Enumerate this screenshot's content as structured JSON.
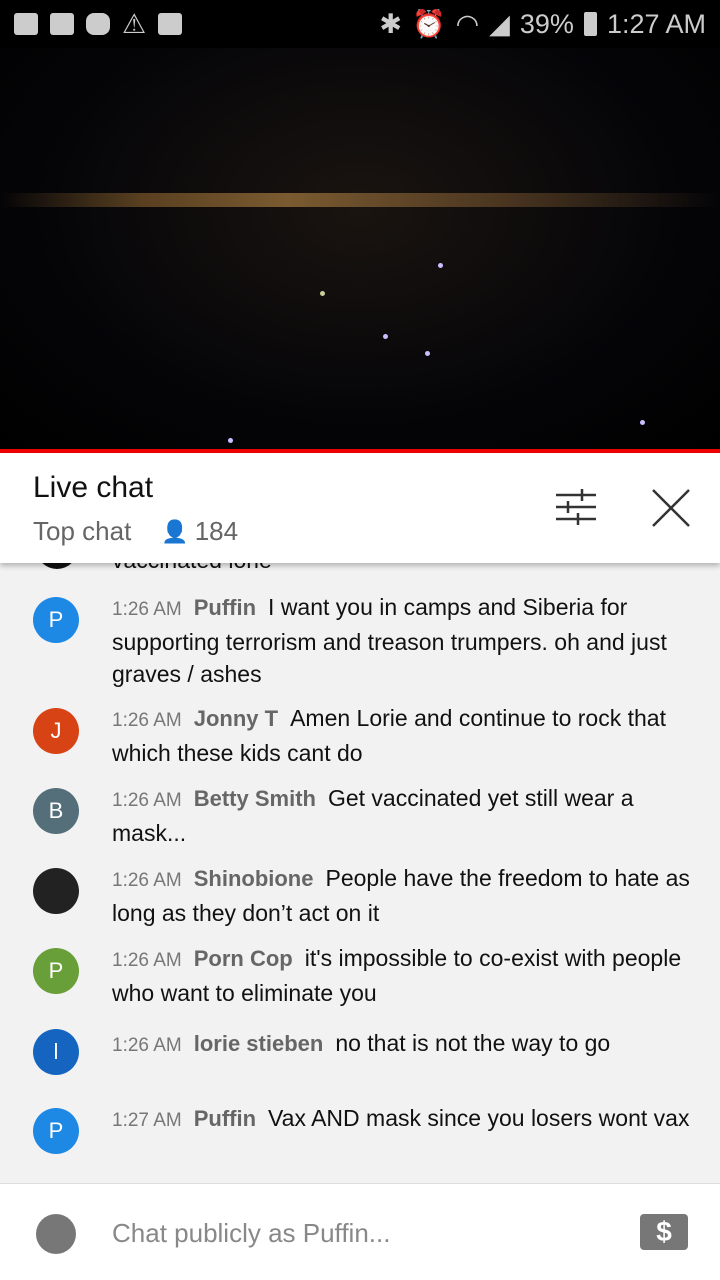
{
  "status": {
    "battery": "39%",
    "time": "1:27 AM"
  },
  "header": {
    "title": "Live chat",
    "mode": "Top chat",
    "viewers": "184"
  },
  "chat": {
    "partial": "vaccinated lorie",
    "messages": [
      {
        "time": "1:26 AM",
        "author": "Puffin",
        "text": "I want you in camps and Siberia for supporting terrorism and treason trumpers. oh and just graves / ashes",
        "initial": "P",
        "color": "#1e88e5"
      },
      {
        "time": "1:26 AM",
        "author": "Jonny T",
        "text": "Amen Lorie and continue to rock that which these kids cant do",
        "initial": "J",
        "color": "#d84315"
      },
      {
        "time": "1:26 AM",
        "author": "Betty Smith",
        "text": "Get vaccinated yet still wear a mask...",
        "initial": "B",
        "color": "#546e7a"
      },
      {
        "time": "1:26 AM",
        "author": "Shinobione",
        "text": "People have the freedom to hate as long as they don’t act on it",
        "initial": "",
        "color": "#222222"
      },
      {
        "time": "1:26 AM",
        "author": "Porn Cop",
        "text": "it's impossible to co-exist with people who want to eliminate you",
        "initial": "P",
        "color": "#689f38"
      },
      {
        "time": "1:26 AM",
        "author": "lorie stieben",
        "text": "no that is not the way to go",
        "initial": "l",
        "color": "#1565c0"
      },
      {
        "time": "1:27 AM",
        "author": "Puffin",
        "text": "Vax AND mask since you losers wont vax",
        "initial": "P",
        "color": "#1e88e5"
      }
    ]
  },
  "input": {
    "placeholder": "Chat publicly as Puffin...",
    "superchat": "$"
  }
}
